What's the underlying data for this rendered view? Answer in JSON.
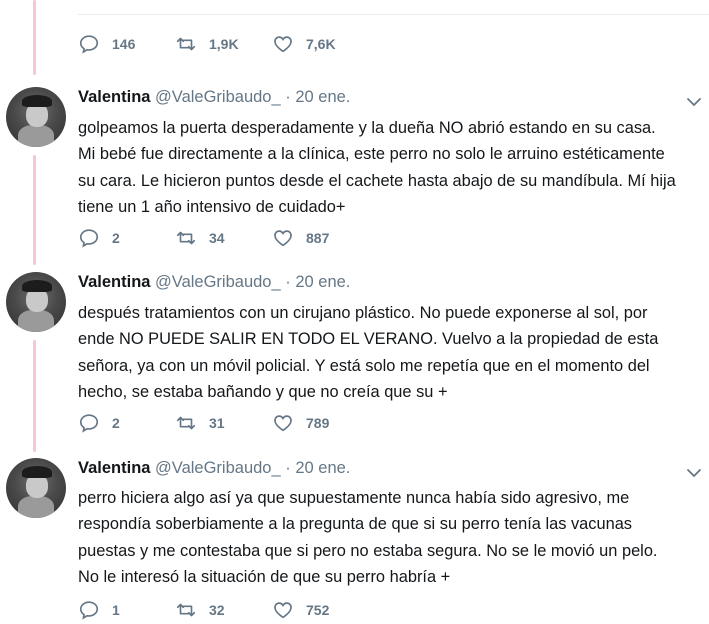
{
  "top_actions": {
    "replies": "146",
    "retweets": "1,9K",
    "likes": "7,6K"
  },
  "tweets": [
    {
      "name": "Valentina",
      "handle": "@ValeGribaudo_",
      "separator": "·",
      "date": "20 ene.",
      "lines": [
        "golpeamos la puerta desperadamente y la dueña NO abrió estando en su casa.",
        "Mi bebé fue directamente a la clínica, este perro no solo le arruino estéticamente",
        "su cara. Le hicieron puntos desde el cachete hasta abajo de su mandíbula. Mí hija",
        "tiene un 1 año intensivo de cuidado+"
      ],
      "replies": "2",
      "retweets": "34",
      "likes": "887"
    },
    {
      "name": "Valentina",
      "handle": "@ValeGribaudo_",
      "separator": "·",
      "date": "20 ene.",
      "lines": [
        "después tratamientos con un cirujano plástico. No puede exponerse al sol, por",
        "ende NO PUEDE SALIR EN TODO EL VERANO. Vuelvo a la propiedad de esta",
        "señora, ya con un móvil policial. Y está solo me repetía que en el momento del",
        "hecho, se estaba bañando y que no creía que su +"
      ],
      "replies": "2",
      "retweets": "31",
      "likes": "789"
    },
    {
      "name": "Valentina",
      "handle": "@ValeGribaudo_",
      "separator": "·",
      "date": "20 ene.",
      "lines": [
        "perro hiciera algo así ya que supuestamente nunca había sido agresivo, me",
        "respondía soberbiamente a la pregunta de que si su perro tenía las vacunas",
        "puestas y me contestaba que si pero no estaba segura. No se le movió un pelo.",
        "No le interesó la situación de que su perro habría +"
      ],
      "replies": "1",
      "retweets": "32",
      "likes": "752"
    }
  ]
}
